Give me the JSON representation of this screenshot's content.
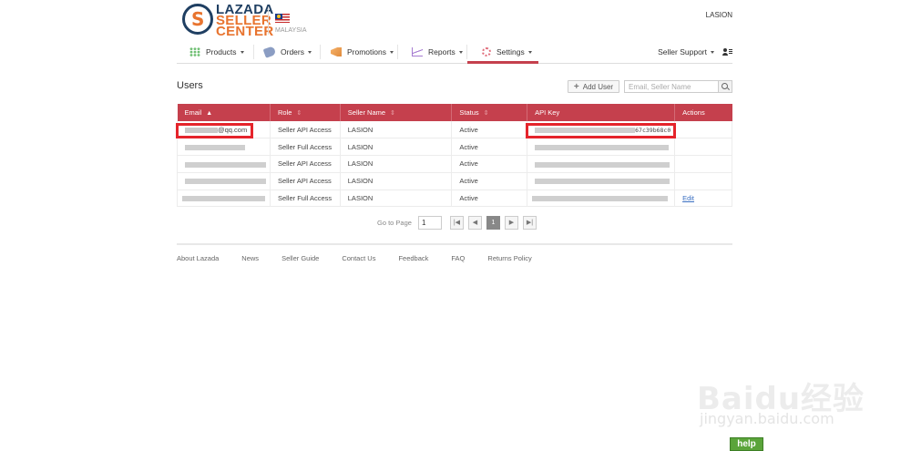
{
  "header": {
    "brand_line1": "LAZADA",
    "brand_line2": "SELLER",
    "brand_line3": "CENTER",
    "logo_letter": "S",
    "country": "MALAYSIA",
    "account_name": "LASION"
  },
  "nav": {
    "items": [
      {
        "label": "Products",
        "icon": "grid-icon"
      },
      {
        "label": "Orders",
        "icon": "tag-icon"
      },
      {
        "label": "Promotions",
        "icon": "megaphone-icon"
      },
      {
        "label": "Reports",
        "icon": "chart-icon"
      },
      {
        "label": "Settings",
        "icon": "gear-icon",
        "active": true
      }
    ],
    "support_label": "Seller Support",
    "accent_color": "#c5404d"
  },
  "users": {
    "title": "Users",
    "add_user_label": "Add User",
    "search_placeholder": "Email, Seller Name"
  },
  "table": {
    "columns": [
      "Email",
      "Role",
      "Seller Name",
      "Status",
      "API Key",
      "Actions"
    ],
    "rows": [
      {
        "email": "@qq.com",
        "role": "Seller API Access",
        "seller": "LASION",
        "status": "Active",
        "api_key": "67c39b68c0",
        "action": ""
      },
      {
        "email": "",
        "role": "Seller Full Access",
        "seller": "LASION",
        "status": "Active",
        "api_key": "",
        "action": ""
      },
      {
        "email": "",
        "role": "Seller API Access",
        "seller": "LASION",
        "status": "Active",
        "api_key": "",
        "action": ""
      },
      {
        "email": "",
        "role": "Seller API Access",
        "seller": "LASION",
        "status": "Active",
        "api_key": "",
        "action": ""
      },
      {
        "email": "",
        "role": "Seller Full Access",
        "seller": "LASION",
        "status": "Active",
        "api_key": "",
        "action": "Edit"
      }
    ]
  },
  "pager": {
    "go_to_label": "Go to Page",
    "page_value": "1",
    "current_page": "1"
  },
  "footer": {
    "links": [
      "About Lazada",
      "News",
      "Seller Guide",
      "Contact Us",
      "Feedback",
      "FAQ",
      "Returns Policy"
    ]
  },
  "watermark": {
    "main": "Baidu经验",
    "sub": "jingyan.baidu.com"
  },
  "help_label": "help"
}
